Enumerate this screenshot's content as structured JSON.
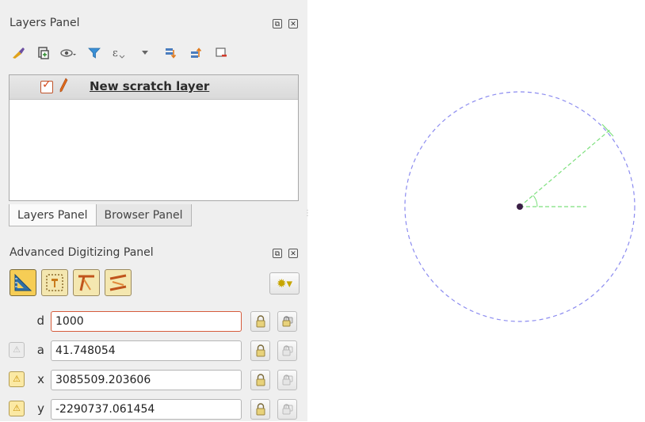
{
  "layers_panel": {
    "title": "Layers Panel",
    "toolbar_icons": [
      "style-manager-icon",
      "add-group-icon",
      "manage-visibility-icon",
      "filter-legend-icon",
      "filter-expression-icon",
      "dropdown-icon",
      "expand-all-icon",
      "collapse-all-icon",
      "remove-layer-icon"
    ],
    "layers": [
      {
        "name": "New scratch layer",
        "checked": true,
        "editing": true
      }
    ]
  },
  "tabs": {
    "layers": "Layers Panel",
    "browser": "Browser Panel"
  },
  "advanced_digitizing": {
    "title": "Advanced Digitizing Panel",
    "tools": [
      "enable-advanced-digitizing-icon",
      "construction-mode-icon",
      "perpendicular-icon",
      "parallel-icon"
    ],
    "settings_icon": "gear-dropdown-icon",
    "fields": {
      "d": {
        "label": "d",
        "value": "1000"
      },
      "a": {
        "label": "a",
        "value": "41.748054"
      },
      "x": {
        "label": "x",
        "value": "3085509.203606"
      },
      "y": {
        "label": "y",
        "value": "-2290737.061454"
      }
    }
  },
  "canvas": {
    "circle_color": "#8c8cf0",
    "guide_color": "#7ee07e",
    "point_color": "#3a1f45"
  }
}
